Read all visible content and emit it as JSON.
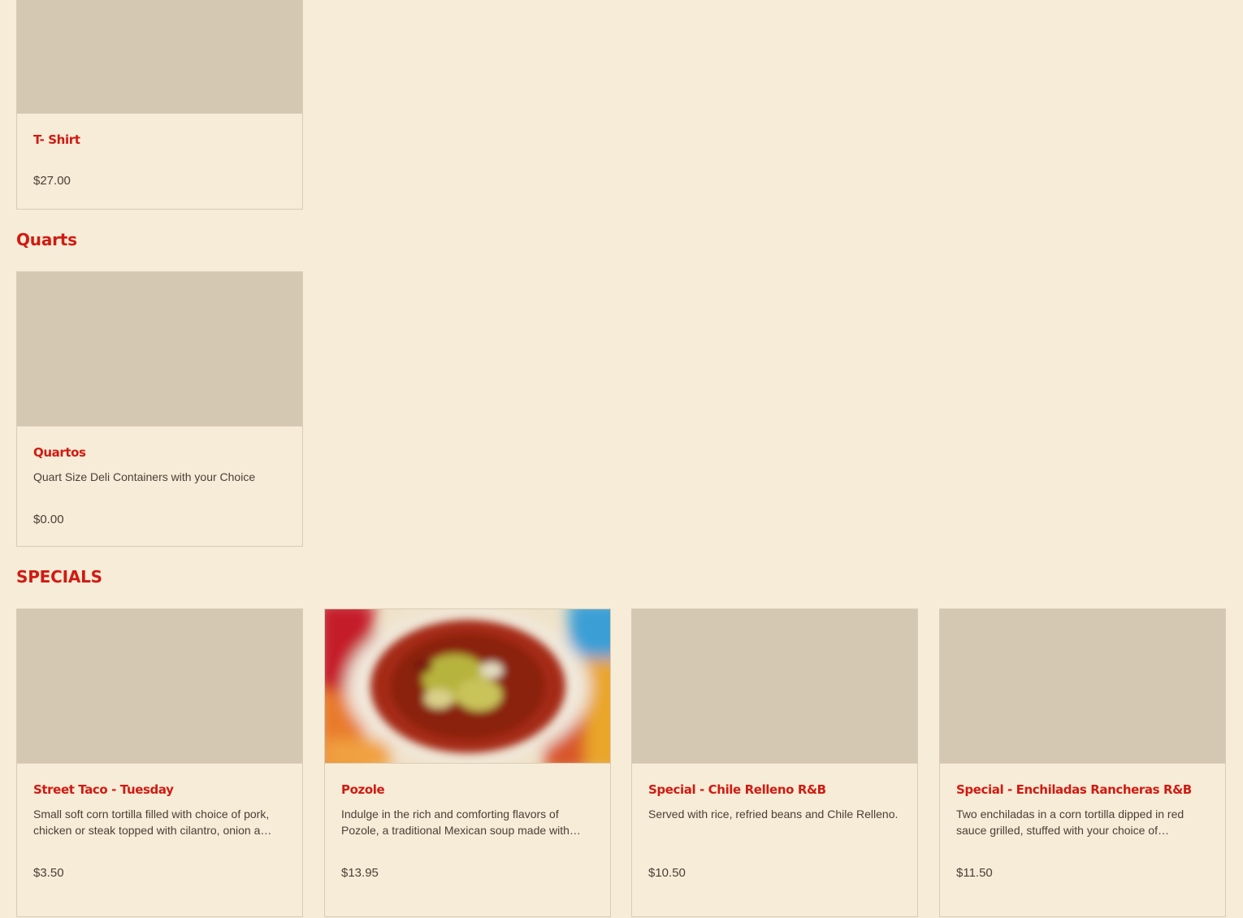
{
  "sections": {
    "merch": {
      "items": [
        {
          "name": "T- Shirt",
          "description": "",
          "price": "$27.00"
        }
      ]
    },
    "quarts": {
      "title": "Quarts",
      "items": [
        {
          "name": "Quartos",
          "description": "Quart Size Deli Containers with your Choice",
          "price": "$0.00"
        }
      ]
    },
    "specials": {
      "title": "SPECIALS",
      "items": [
        {
          "name": "Street Taco - Tuesday",
          "description": "Small soft corn tortilla filled with choice of pork, chicken or steak topped with cilantro, onion a…",
          "price": "$3.50"
        },
        {
          "name": "Pozole",
          "description": "Indulge in the rich and comforting flavors of Pozole, a traditional Mexican soup made with…",
          "price": "$13.95"
        },
        {
          "name": "Special - Chile Relleno R&B",
          "description": "Served with rice, refried beans and Chile Relleno.",
          "price": "$10.50"
        },
        {
          "name": "Special - Enchiladas Rancheras R&B",
          "description": "Two enchiladas in a corn tortilla dipped in red sauce grilled, stuffed with your choice of…",
          "price": "$11.50"
        }
      ]
    }
  },
  "colors": {
    "accent": "#d11a12",
    "background": "#f7ecd7",
    "placeholder": "#d4c8b3"
  }
}
